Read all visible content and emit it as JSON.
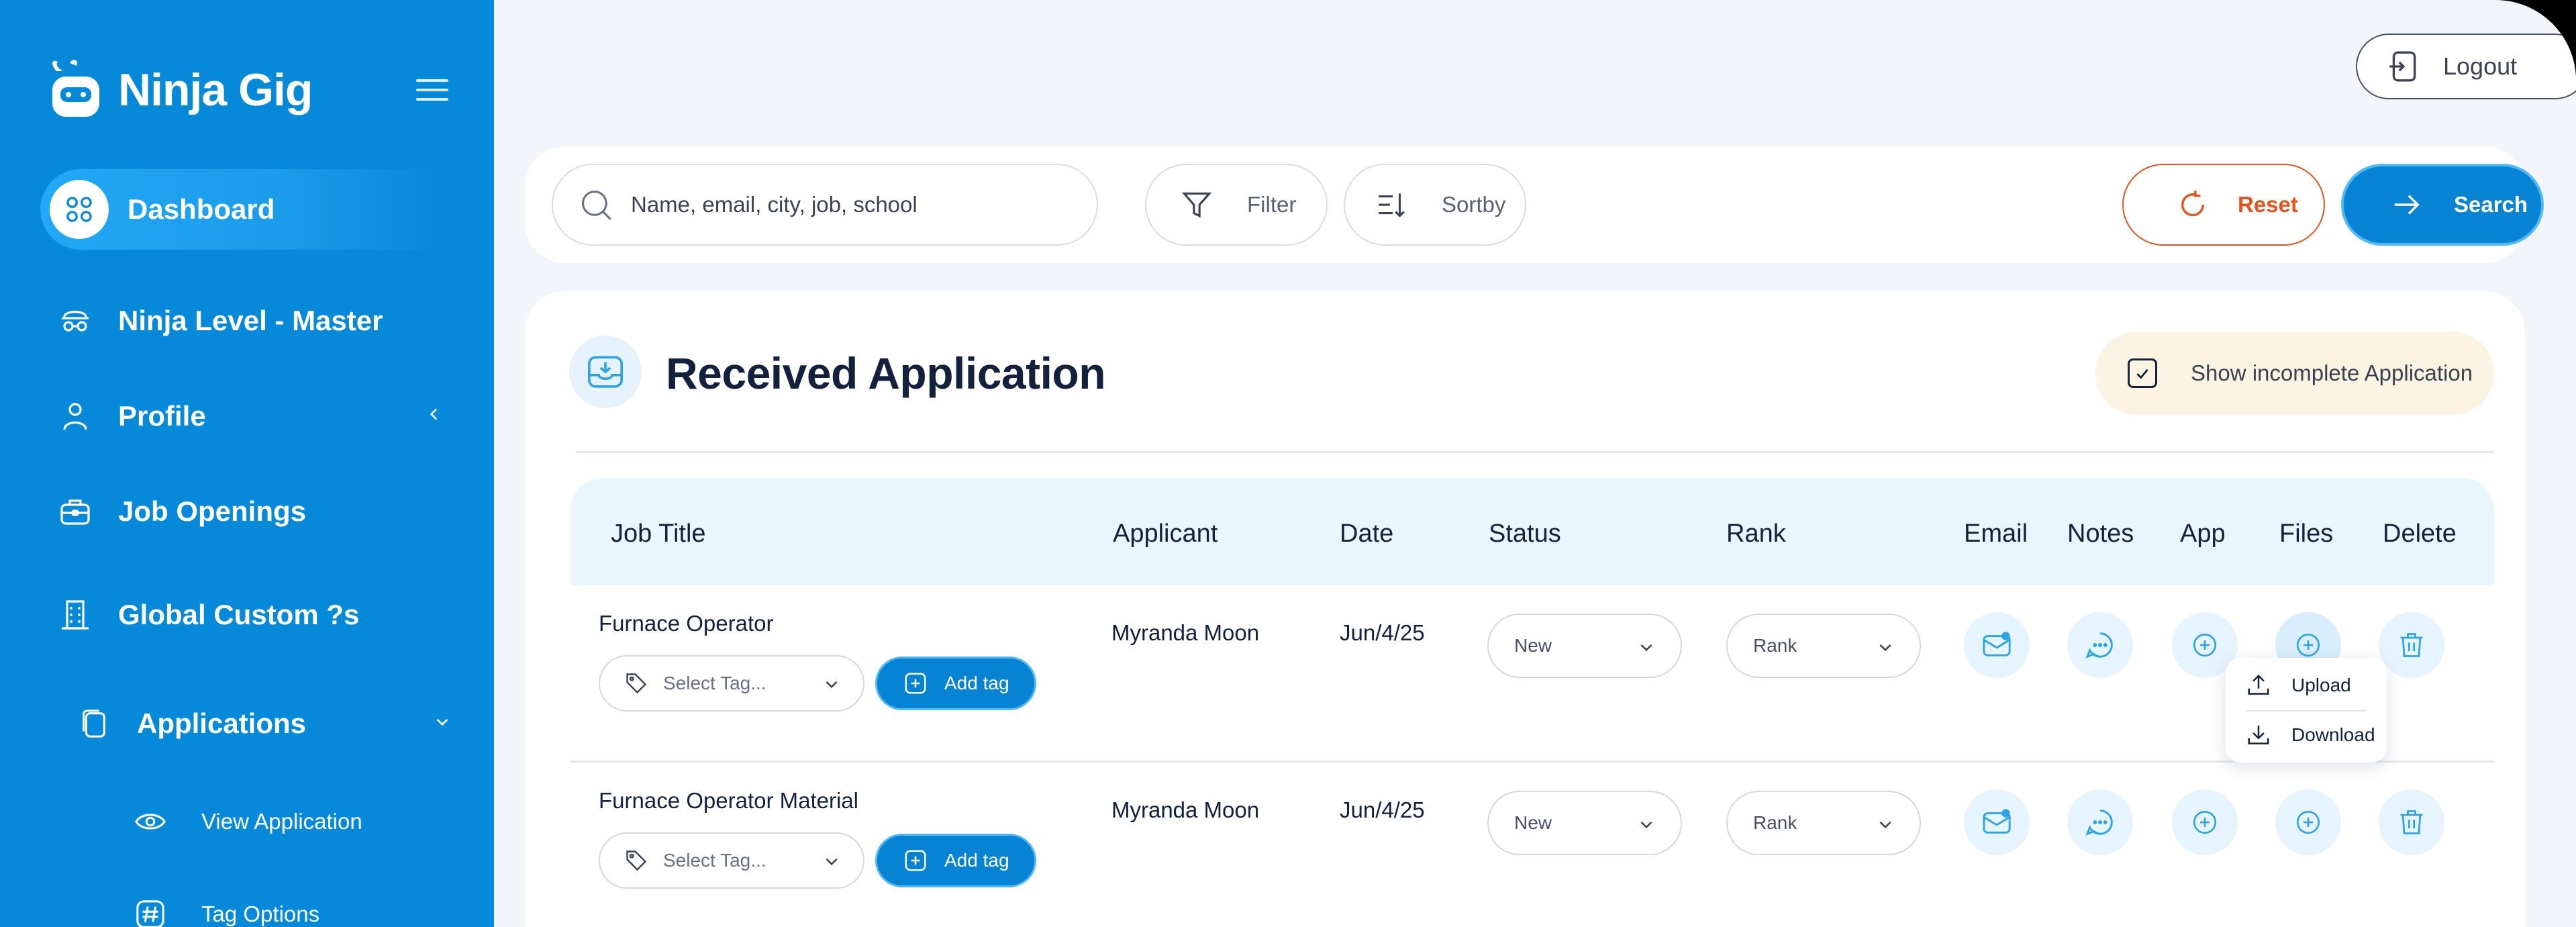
{
  "brand": {
    "name": "Ninja Gig"
  },
  "sidebar": {
    "items": [
      {
        "label": "Dashboard",
        "icon": "grid-icon",
        "active": true
      },
      {
        "label": "Ninja Level - Master",
        "icon": "ninja-icon"
      },
      {
        "label": "Profile",
        "icon": "user-icon"
      },
      {
        "label": "Job Openings",
        "icon": "briefcase-icon"
      },
      {
        "label": "Global Custom ?s",
        "icon": "building-icon"
      },
      {
        "label": "Applications",
        "icon": "documents-icon"
      }
    ],
    "sub_items": [
      {
        "label": "View Application",
        "icon": "eye-icon"
      },
      {
        "label": "Tag Options",
        "icon": "hash-icon"
      }
    ]
  },
  "header": {
    "logout_label": "Logout"
  },
  "search": {
    "placeholder": "Name, email, city, job, school",
    "filter_label": "Filter",
    "sort_label": "Sortby",
    "reset_label": "Reset",
    "search_label": "Search"
  },
  "card": {
    "title": "Received Application",
    "incomplete_label": "Show incomplete Application"
  },
  "table": {
    "columns": [
      "Job Title",
      "Applicant",
      "Date",
      "Status",
      "Rank",
      "Email",
      "Notes",
      "App",
      "Files",
      "Delete"
    ],
    "rows": [
      {
        "job_title": "Furnace Operator",
        "applicant": "Myranda Moon",
        "date": "Jun/4/25",
        "status": "New",
        "rank": "Rank",
        "tag_placeholder": "Select Tag...",
        "add_tag_label": "Add tag"
      },
      {
        "job_title": "Furnace Operator Material",
        "applicant": "Myranda Moon",
        "date": "Jun/4/25",
        "status": "New",
        "rank": "Rank",
        "tag_placeholder": "Select Tag...",
        "add_tag_label": "Add tag"
      }
    ]
  },
  "files_menu": {
    "upload_label": "Upload",
    "download_label": "Download"
  },
  "colors": {
    "sidebar": "#0689d8",
    "primary": "#0683d2",
    "reset": "#e2541c",
    "text_dark": "#14213d",
    "header_bg": "#e8f6fe"
  }
}
